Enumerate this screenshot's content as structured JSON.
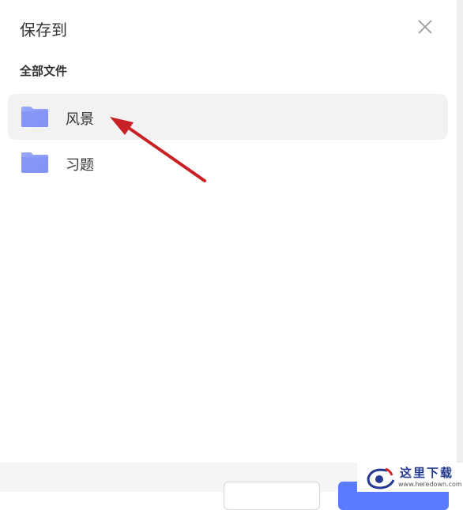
{
  "dialog": {
    "title": "保存到",
    "section_label": "全部文件",
    "folders": [
      {
        "name": "风景",
        "selected": true,
        "icon": "folder-icon"
      },
      {
        "name": "习题",
        "selected": false,
        "icon": "folder-icon"
      }
    ]
  },
  "watermark": {
    "text": "这里下载",
    "url": "www.heredown.com"
  },
  "colors": {
    "folder": "#8b9cf7",
    "selected_row": "#f2f2f2",
    "arrow": "#d0262a",
    "primary": "#5a7bff",
    "link": "#3f73f1"
  }
}
